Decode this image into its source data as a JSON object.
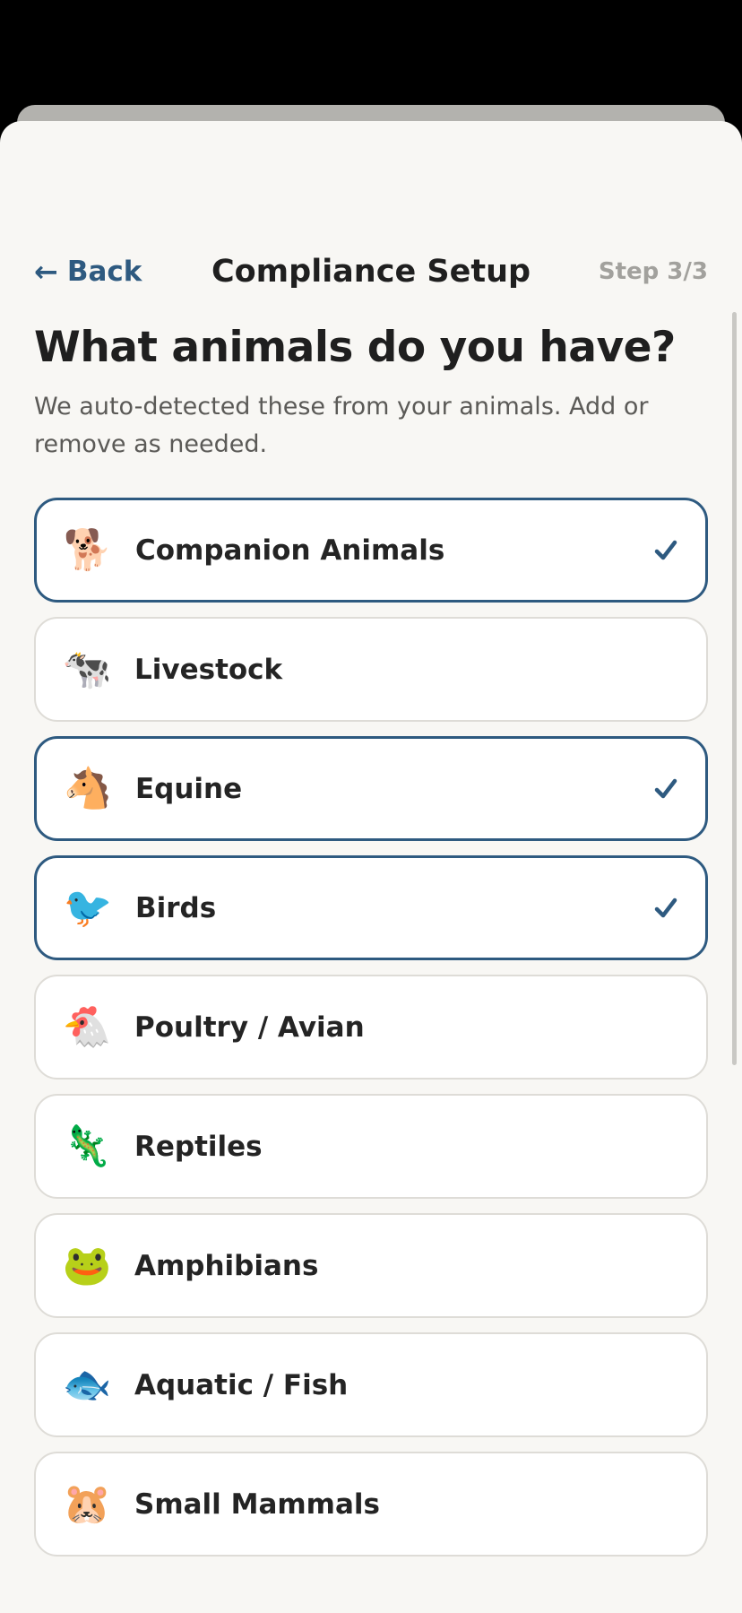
{
  "header": {
    "back_label": "Back",
    "title": "Compliance Setup",
    "step": "Step 3/3"
  },
  "main": {
    "heading": "What animals do you have?",
    "subtitle": "We auto-detected these from your animals. Add or remove as needed."
  },
  "options": [
    {
      "label": "Companion Animals",
      "icon": "dog-icon",
      "emoji": "🐕",
      "selected": true
    },
    {
      "label": "Livestock",
      "icon": "cow-icon",
      "emoji": "🐄",
      "selected": false
    },
    {
      "label": "Equine",
      "icon": "horse-icon",
      "emoji": "🐴",
      "selected": true
    },
    {
      "label": "Birds",
      "icon": "bird-icon",
      "emoji": "🐦",
      "selected": true
    },
    {
      "label": "Poultry / Avian",
      "icon": "chicken-icon",
      "emoji": "🐔",
      "selected": false
    },
    {
      "label": "Reptiles",
      "icon": "lizard-icon",
      "emoji": "🦎",
      "selected": false
    },
    {
      "label": "Amphibians",
      "icon": "frog-icon",
      "emoji": "🐸",
      "selected": false
    },
    {
      "label": "Aquatic / Fish",
      "icon": "fish-icon",
      "emoji": "🐟",
      "selected": false
    },
    {
      "label": "Small Mammals",
      "icon": "hamster-icon",
      "emoji": "🐹",
      "selected": false
    }
  ],
  "colors": {
    "accent": "#2e5a80",
    "background": "#f8f7f4",
    "card_border": "#dedcd7",
    "muted_text": "#a2a19d"
  }
}
